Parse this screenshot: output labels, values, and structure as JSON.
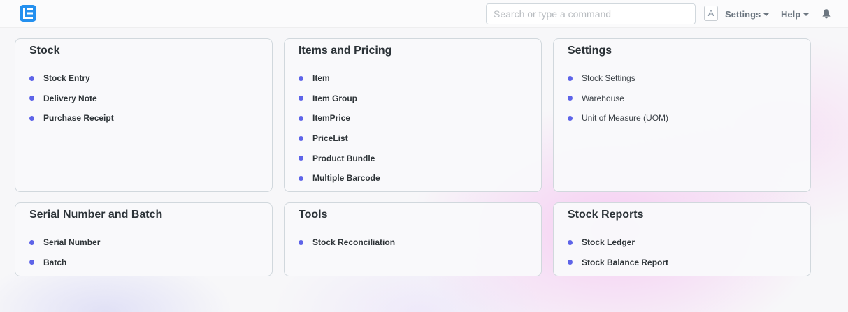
{
  "navbar": {
    "search_placeholder": "Search or type a command",
    "avatar_letter": "A",
    "settings_label": "Settings",
    "help_label": "Help",
    "logo_icon": "erpnext-logo-icon",
    "bell_icon": "bell-icon",
    "accent_color": "#2490ef"
  },
  "cards": [
    {
      "title": "Stock",
      "links": [
        "Stock Entry",
        "Delivery Note",
        "Purchase Receipt"
      ]
    },
    {
      "title": "Items and Pricing",
      "links": [
        "Item",
        "Item Group",
        "ItemPrice",
        "PriceList",
        "Product Bundle",
        "Multiple Barcode"
      ]
    },
    {
      "title": "Settings",
      "links": [
        "Stock Settings",
        "Warehouse",
        "Unit of Measure (UOM)"
      ]
    },
    {
      "title": "Serial Number and Batch",
      "links": [
        "Serial Number",
        "Batch"
      ]
    },
    {
      "title": "Tools",
      "links": [
        "Stock Reconciliation"
      ]
    },
    {
      "title": "Stock Reports",
      "links": [
        "Stock Ledger",
        "Stock Balance Report"
      ]
    }
  ],
  "bullet_color": "#5e64e8"
}
